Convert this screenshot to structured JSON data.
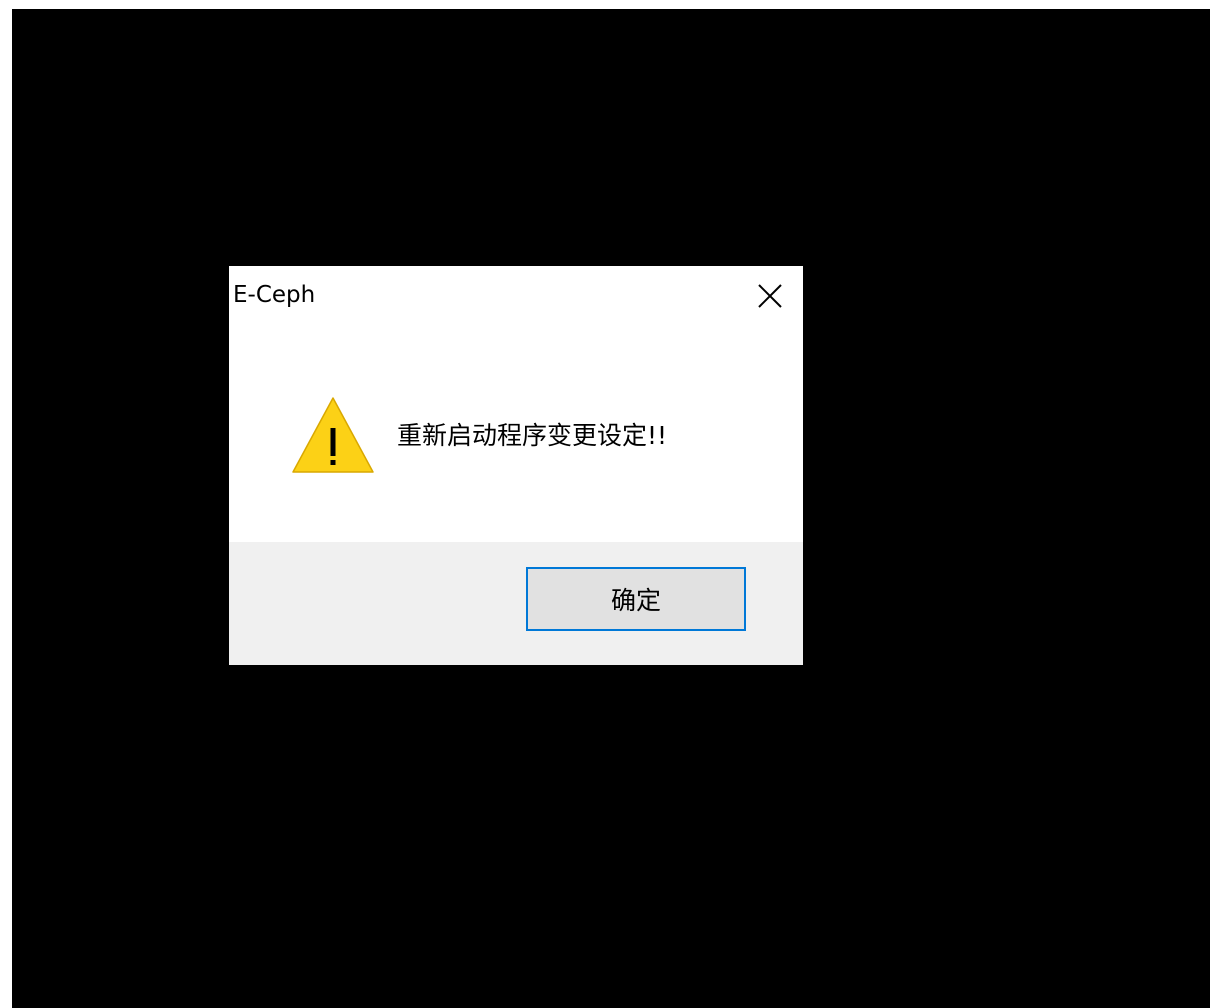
{
  "dialog": {
    "title": "E-Ceph",
    "close_icon": "close-icon",
    "icon": "warning-icon",
    "message": "重新启动程序变更设定!!",
    "ok_label": "确定"
  },
  "colors": {
    "background": "#000000",
    "dialog_bg": "#ffffff",
    "footer_bg": "#f0f0f0",
    "button_bg": "#e1e1e1",
    "button_border": "#0078d7",
    "warning_fill": "#fcd116",
    "warning_stroke": "#d9a800"
  }
}
